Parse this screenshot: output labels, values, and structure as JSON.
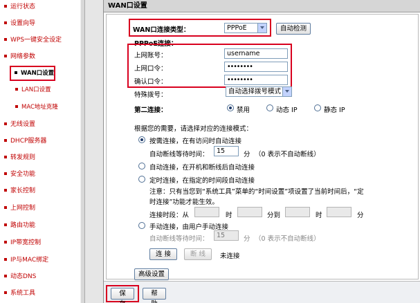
{
  "sidebar": {
    "items": [
      {
        "label": "运行状态"
      },
      {
        "label": "设置向导"
      },
      {
        "label": "WPS一键安全设定"
      },
      {
        "label": "网络参数"
      },
      {
        "label": "WAN口设置"
      },
      {
        "label": "LAN口设置"
      },
      {
        "label": "MAC地址克隆"
      },
      {
        "label": "无线设置"
      },
      {
        "label": "DHCP服务器"
      },
      {
        "label": "转发规则"
      },
      {
        "label": "安全功能"
      },
      {
        "label": "家长控制"
      },
      {
        "label": "上网控制"
      },
      {
        "label": "路由功能"
      },
      {
        "label": "IP带宽控制"
      },
      {
        "label": "IP与MAC绑定"
      },
      {
        "label": "动态DNS"
      },
      {
        "label": "系统工具"
      }
    ]
  },
  "panel": {
    "title": "WAN口设置",
    "wan_type_label": "WAN口连接类型：",
    "wan_type_value": "PPPoE",
    "auto_detect_label": "自动检测",
    "pppoe_heading": "PPPoE连接：",
    "username_label": "上网账号：",
    "username_value": "username",
    "password_label": "上网口令：",
    "password_value": "••••••••",
    "confirm_label": "确认口令：",
    "confirm_value": "••••••••",
    "dial_label": "特殊拨号：",
    "dial_value": "自动选择拨号模式",
    "second_label": "第二连接：",
    "second_options": [
      "禁用",
      "动态 IP",
      "静态 IP"
    ],
    "mode_prompt": "根据您的需要，请选择对应的连接模式：",
    "mode_on_demand": "按需连接，在有访问时自动连接",
    "idle_label": "自动断线等待时间：",
    "idle_value": "15",
    "idle_unit": "分",
    "idle_note": "（0 表示不自动断线）",
    "mode_auto": "自动连接，在开机和断线后自动连接",
    "mode_timed": "定时连接，在指定的时间段自动连接",
    "timed_note_line1": "注意：只有当您到“系统工具”菜单的“时间设置”项设置了当前时间后，“定",
    "timed_note_line2": "时连接”功能才能生效。",
    "period_label": "连接时段：从",
    "period_hour": "时",
    "period_min_to": "分到",
    "period_hour2": "时",
    "period_min2": "分",
    "mode_manual": "手动连接，由用户手动连接",
    "idle2_value": "15",
    "connect_label": "连 接",
    "disconnect_label": "断 线",
    "status_text": "未连接",
    "advanced_label": "高级设置"
  },
  "footer": {
    "save_label": "保 存",
    "help_label": "帮 助"
  }
}
